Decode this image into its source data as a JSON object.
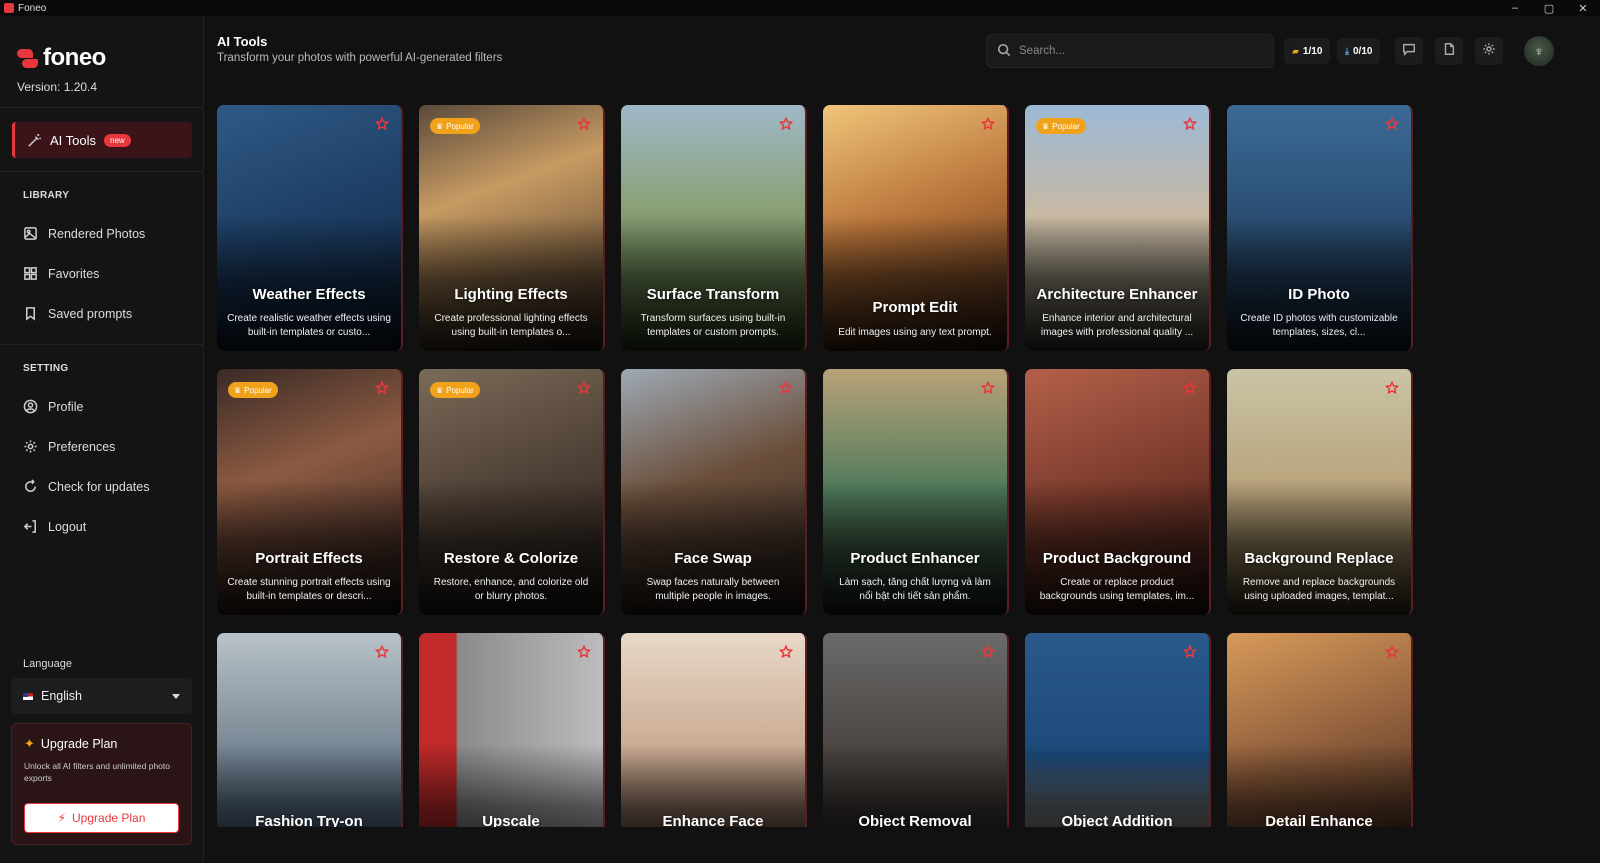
{
  "window": {
    "title": "Foneo",
    "controls": [
      "–",
      "▢",
      "✕"
    ]
  },
  "sidebar": {
    "logo": "foneo",
    "version": "Version: 1.20.4",
    "active_item": {
      "label": "AI Tools",
      "badge": "new"
    },
    "library_title": "LIBRARY",
    "library_items": [
      {
        "label": "Rendered Photos",
        "icon": "image-icon"
      },
      {
        "label": "Favorites",
        "icon": "grid-icon"
      },
      {
        "label": "Saved prompts",
        "icon": "bookmark-icon"
      }
    ],
    "setting_title": "SETTING",
    "setting_items": [
      {
        "label": "Profile",
        "icon": "profile-icon"
      },
      {
        "label": "Preferences",
        "icon": "gear-icon"
      },
      {
        "label": "Check for updates",
        "icon": "refresh-icon"
      },
      {
        "label": "Logout",
        "icon": "logout-icon"
      }
    ],
    "language_label": "Language",
    "language_value": "English",
    "upgrade": {
      "title": "Upgrade Plan",
      "desc": "Unlock all AI filters and unlimited photo exports",
      "button": "Upgrade Plan"
    }
  },
  "header": {
    "title": "AI Tools",
    "subtitle": "Transform your photos with powerful AI-generated filters",
    "search_placeholder": "Search...",
    "counter_credits": "1/10",
    "counter_exports": "0/10"
  },
  "colors": {
    "accent": "#e8383d",
    "popular": "#f0a21b",
    "background": "#111112"
  },
  "cards": [
    {
      "title": "Weather Effects",
      "desc": "Create realistic weather effects using built-in templates or custo...",
      "popular": false
    },
    {
      "title": "Lighting Effects",
      "desc": "Create professional lighting effects using built-in templates o...",
      "popular": true
    },
    {
      "title": "Surface Transform",
      "desc": "Transform surfaces using built-in templates or custom prompts.",
      "popular": false
    },
    {
      "title": "Prompt Edit",
      "desc": "Edit images using any text prompt.",
      "popular": false
    },
    {
      "title": "Architecture Enhancer",
      "desc": "Enhance interior and architectural images with professional quality ...",
      "popular": true
    },
    {
      "title": "ID Photo",
      "desc": "Create ID photos with customizable templates, sizes, cl...",
      "popular": false
    },
    {
      "title": "Portrait Effects",
      "desc": "Create stunning portrait effects using built-in templates or descri...",
      "popular": true
    },
    {
      "title": "Restore & Colorize",
      "desc": "Restore, enhance, and colorize old or blurry photos.",
      "popular": true
    },
    {
      "title": "Face Swap",
      "desc": "Swap faces naturally between multiple people in images.",
      "popular": false
    },
    {
      "title": "Product Enhancer",
      "desc": "Làm sạch, tăng chất lượng và làm nổi bật chi tiết sản phẩm.",
      "popular": false
    },
    {
      "title": "Product Background",
      "desc": "Create or replace product backgrounds using templates, im...",
      "popular": false
    },
    {
      "title": "Background Replace",
      "desc": "Remove and replace backgrounds using uploaded images, templat...",
      "popular": false
    },
    {
      "title": "Fashion Try-on",
      "desc": "",
      "popular": false
    },
    {
      "title": "Upscale",
      "desc": "",
      "popular": false
    },
    {
      "title": "Enhance Face",
      "desc": "",
      "popular": false
    },
    {
      "title": "Object Removal",
      "desc": "",
      "popular": false
    },
    {
      "title": "Object Addition",
      "desc": "",
      "popular": false
    },
    {
      "title": "Detail Enhance",
      "desc": "",
      "popular": false
    }
  ],
  "popular_label": "Popular"
}
